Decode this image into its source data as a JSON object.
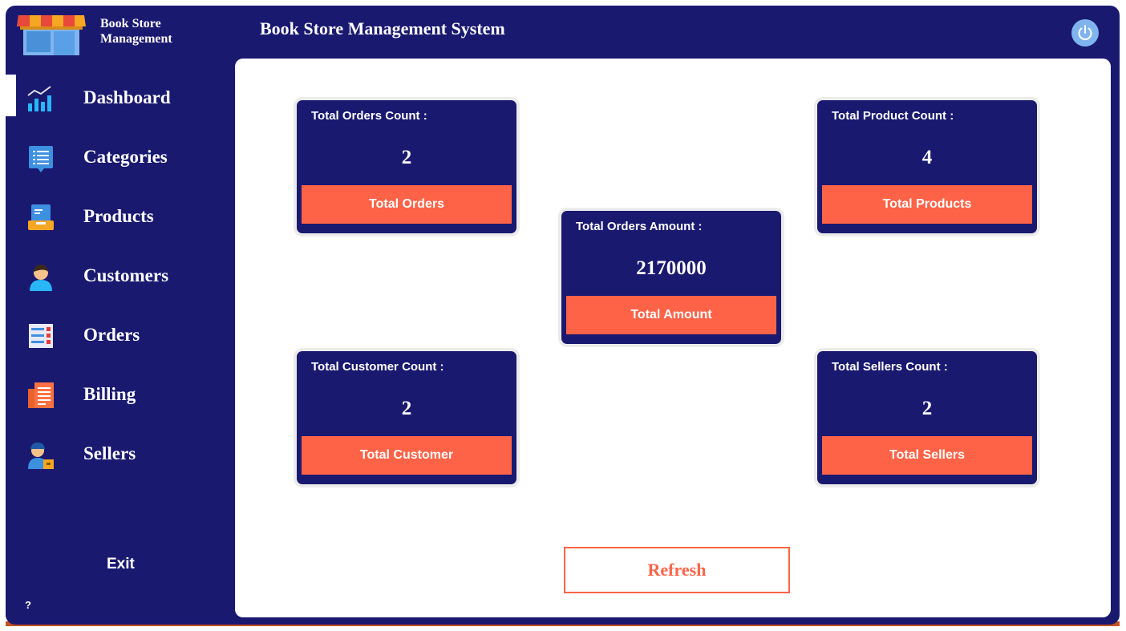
{
  "app": {
    "brand_line1": "Book Store",
    "brand_line2": "Management",
    "title": "Book Store Management System"
  },
  "sidebar": {
    "items": [
      {
        "label": "Dashboard",
        "icon": "dashboard-chart-icon"
      },
      {
        "label": "Categories",
        "icon": "categories-list-icon"
      },
      {
        "label": "Products",
        "icon": "products-box-icon"
      },
      {
        "label": "Customers",
        "icon": "customer-person-icon"
      },
      {
        "label": "Orders",
        "icon": "orders-checklist-icon"
      },
      {
        "label": "Billing",
        "icon": "billing-receipt-icon"
      },
      {
        "label": "Sellers",
        "icon": "seller-delivery-icon"
      }
    ],
    "active": "Dashboard",
    "exit_label": "Exit",
    "help_label": "?"
  },
  "cards": {
    "orders": {
      "label": "Total Orders Count :",
      "value": "2",
      "button": "Total Orders"
    },
    "products": {
      "label": "Total Product Count :",
      "value": "4",
      "button": "Total Products"
    },
    "amount": {
      "label": "Total Orders Amount :",
      "value": "2170000",
      "button": "Total Amount"
    },
    "customers": {
      "label": "Total Customer Count :",
      "value": "2",
      "button": "Total Customer"
    },
    "sellers": {
      "label": "Total Sellers Count :",
      "value": "2",
      "button": "Total Sellers"
    }
  },
  "refresh_label": "Refresh",
  "colors": {
    "navy": "#191970",
    "accent": "#ff6347",
    "power": "#7fb4ee",
    "panel": "#ffffff"
  }
}
